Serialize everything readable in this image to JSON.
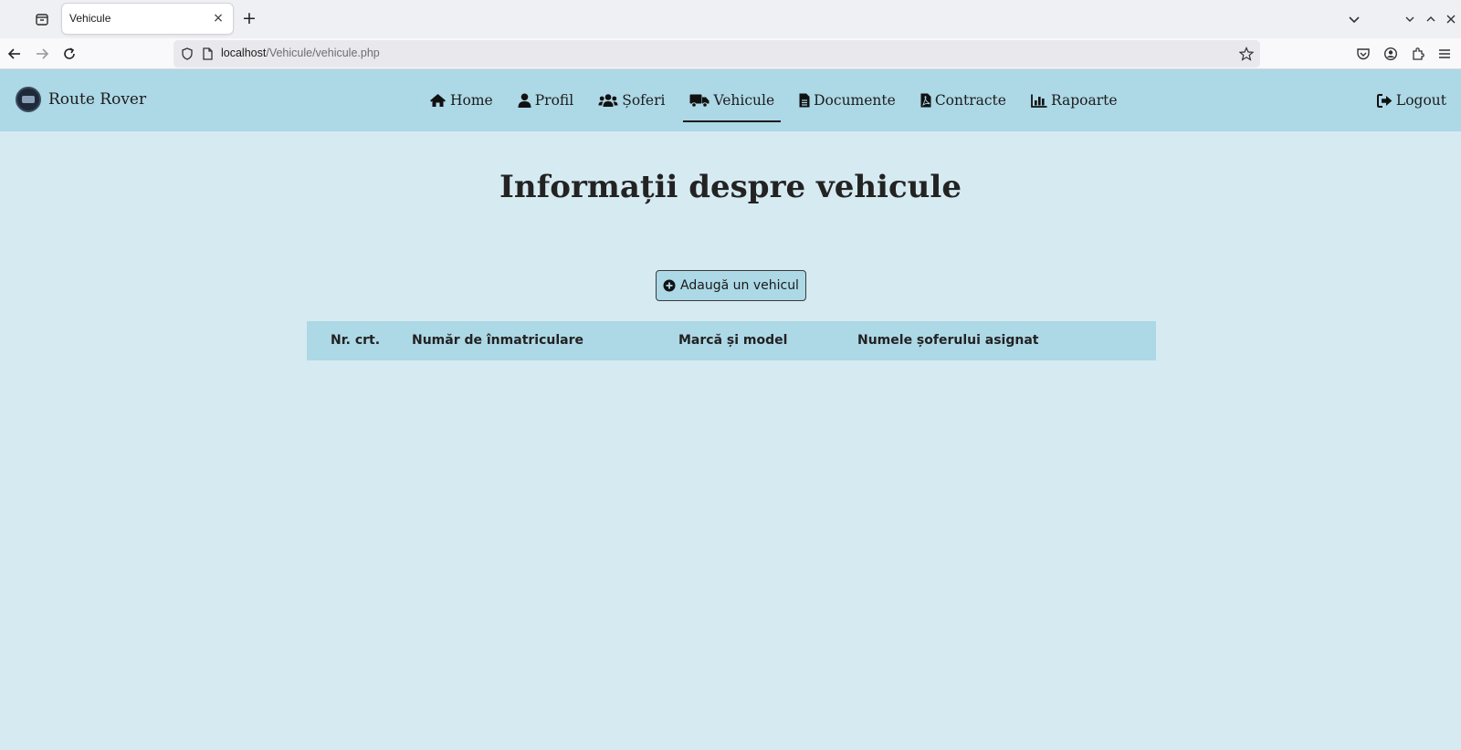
{
  "browser": {
    "tab_title": "Vehicule",
    "tab_close": "×",
    "new_tab": "+",
    "url_host": "localhost",
    "url_path": "/Vehicule/vehicule.php"
  },
  "header": {
    "brand": "Route Rover",
    "menu": [
      {
        "label": "Home",
        "icon": "home-icon"
      },
      {
        "label": "Profil",
        "icon": "user-icon"
      },
      {
        "label": "Șoferi",
        "icon": "users-icon"
      },
      {
        "label": "Vehicule",
        "icon": "truck-icon",
        "active": true
      },
      {
        "label": "Documente",
        "icon": "document-icon"
      },
      {
        "label": "Contracte",
        "icon": "pdf-file-icon"
      },
      {
        "label": "Rapoarte",
        "icon": "bar-chart-icon"
      }
    ],
    "logout": "Logout"
  },
  "main": {
    "title": "Informații despre vehicule",
    "add_button": "Adaugă un vehicul",
    "table": {
      "columns": [
        "Nr. crt.",
        "Număr de înmatriculare",
        "Marcă și model",
        "Numele șoferului asignat"
      ],
      "rows": []
    }
  },
  "colors": {
    "header_bg": "#add8e6",
    "page_bg": "#d6eaf1"
  }
}
